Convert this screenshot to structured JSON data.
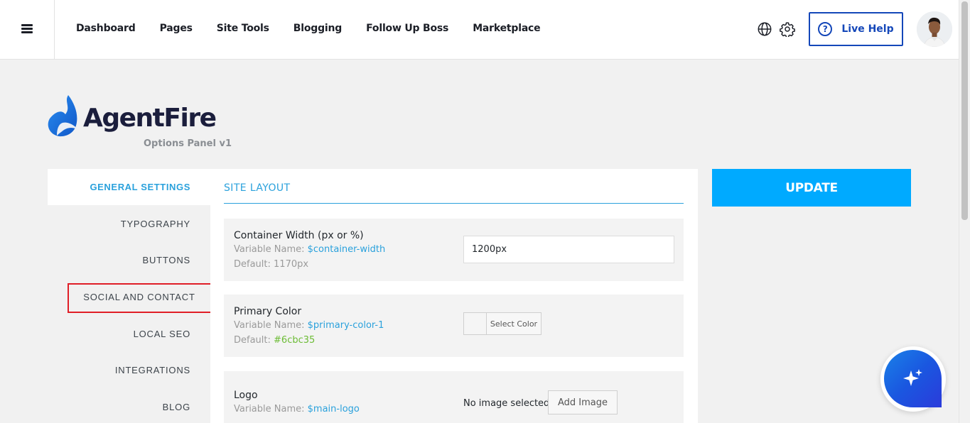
{
  "nav": {
    "menu_icon": "hamburger-menu-icon",
    "items": [
      "Dashboard",
      "Pages",
      "Site Tools",
      "Blogging",
      "Follow Up Boss",
      "Marketplace"
    ]
  },
  "header": {
    "globe_icon": "globe-icon",
    "settings_icon": "gear-icon",
    "live_help_label": "Live Help",
    "live_help_icon": "?"
  },
  "logo": {
    "brand": "AgentFire",
    "subtitle": "Options Panel v1"
  },
  "sidebar": {
    "items": [
      {
        "label": "GENERAL SETTINGS",
        "active": true
      },
      {
        "label": "TYPOGRAPHY",
        "active": false
      },
      {
        "label": "BUTTONS",
        "active": false
      },
      {
        "label": "SOCIAL AND CONTACT",
        "active": false,
        "highlighted": true
      },
      {
        "label": "LOCAL SEO",
        "active": false
      },
      {
        "label": "INTEGRATIONS",
        "active": false
      },
      {
        "label": "BLOG",
        "active": false
      }
    ]
  },
  "main": {
    "section_title": "SITE LAYOUT",
    "fields": [
      {
        "label": "Container Width (px or %)",
        "var_prefix": "Variable Name:",
        "var_name": "$container-width",
        "default_prefix": "Default:",
        "default_value": "1170px",
        "value": "1200px"
      },
      {
        "label": "Primary Color",
        "var_prefix": "Variable Name:",
        "var_name": "$primary-color-1",
        "default_prefix": "Default:",
        "default_value": "#6cbc35",
        "button_label": "Select Color"
      },
      {
        "label": "Logo",
        "var_prefix": "Variable Name:",
        "var_name": "$main-logo",
        "status_text": "No image selected",
        "button_label": "Add Image"
      }
    ]
  },
  "update_label": "UPDATE",
  "colors": {
    "accent": "#2aa1dc",
    "update_button": "#00aaff",
    "live_help": "#1447b9",
    "highlight_border": "#e01e27",
    "default_green": "#6cbc35"
  },
  "fab_icon": "sparkle-icon"
}
